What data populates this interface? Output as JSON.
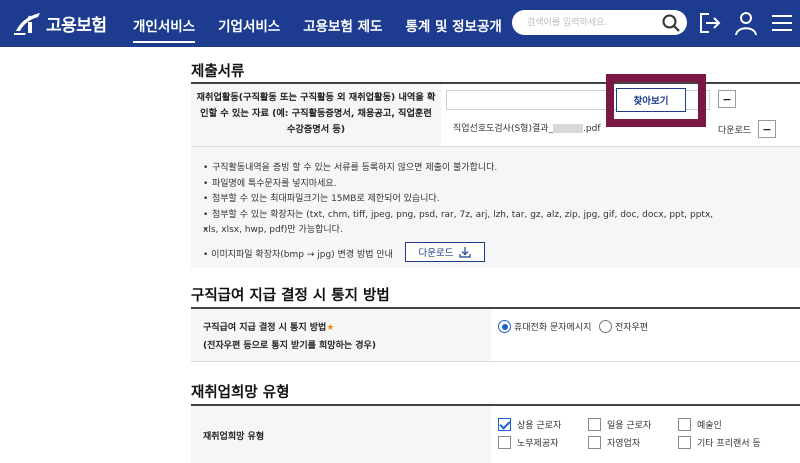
{
  "header": {
    "logo_text": "고용보험",
    "nav": [
      "개인서비스",
      "기업서비스",
      "고용보험 제도",
      "통계 및 정보공개"
    ],
    "active_nav": "개인서비스",
    "search_placeholder": "검색어를 입력하세요.",
    "icons": [
      "logo-icon",
      "search-icon",
      "logout-icon",
      "user-icon",
      "menu-icon"
    ],
    "bg_color": "#1d3b8f"
  },
  "documents": {
    "title": "제출서류",
    "row_label_1": "재취업활동(구직활동 또는 구직활동 외 재취업활동) 내역을 확",
    "row_label_2": "인할 수 있는 자료 (예: 구직활동증명서, 채용공고, 직업훈련",
    "row_label_3": "수강증명서 등)",
    "find_button": "찾아보기",
    "minus": "−",
    "file_name": "직업선호도검사(S형)결과_",
    "file_ext": ".pdf",
    "download_label": "다운로드",
    "highlight_color": "#7c1845"
  },
  "notes": {
    "items": [
      "구직활동내역을 증빙 할 수 있는 서류를 등록하지 않으면 제출이 불가합니다.",
      "파일명에 특수문자를 넣지마세요.",
      "첨부할 수 있는 최대파일크기는 15MB로 제한되어 있습니다.",
      "첨부할 수 있는 확장자는 (txt, chm, tiff, jpeg, png, psd, rar, 7z, arj, lzh, tar, gz, alz, zip, jpg, gif, doc, docx, ppt, pptx,",
      "xls, xlsx, hwp, pdf)만 가능합니다."
    ],
    "image_convert_label": "이미지파일 확장자(bmp → jpg) 변경 방법 안내",
    "download_button": "다운로드"
  },
  "notify": {
    "title": "구직급여 지급 결정 시 통지 방법",
    "label_1": "구직급여 지급 결정 시 통지 방법",
    "required_mark": "★",
    "label_2": "(전자우편 등으로 통지 받기를 희망하는 경우)",
    "options": [
      "휴대전화 문자메시지",
      "전자우편"
    ],
    "selected": "휴대전화 문자메시지"
  },
  "reemploy": {
    "title": "재취업희망 유형",
    "label": "재취업희망 유형",
    "options": [
      "상용 근로자",
      "일용 근로자",
      "예술인",
      "노무제공자",
      "자영업자",
      "기타 프리랜서 등"
    ],
    "checked": [
      "상용 근로자"
    ]
  }
}
